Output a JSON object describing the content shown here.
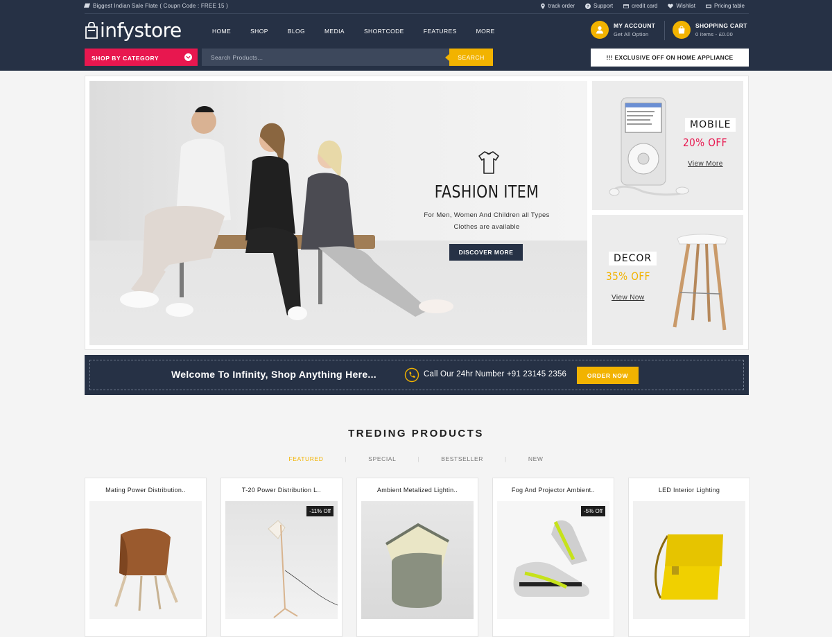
{
  "topbar": {
    "promo": "Biggest Indian Sale Flate ( Coupn Code : FREE 15 )",
    "links": [
      {
        "label": "track order",
        "icon": "location-pin-icon"
      },
      {
        "label": "Support",
        "icon": "help-circle-icon"
      },
      {
        "label": "credit card",
        "icon": "credit-card-icon"
      },
      {
        "label": "Wishlist",
        "icon": "heart-icon"
      },
      {
        "label": "Pricing table",
        "icon": "tag-icon"
      }
    ]
  },
  "logo": {
    "text": "infystore"
  },
  "nav": [
    "HOME",
    "SHOP",
    "BLOG",
    "MEDIA",
    "SHORTCODE",
    "FEATURES",
    "MORE"
  ],
  "account": {
    "title": "MY ACCOUNT",
    "subtitle": "Get All Option"
  },
  "cart": {
    "title": "SHOPPING CART",
    "subtitle": "0 items - £0.00"
  },
  "category_button": "SHOP BY CATEGORY",
  "search": {
    "placeholder": "Search Products...",
    "button": "SEARCH"
  },
  "exclusive": "!!! EXCLUSIVE OFF ON HOME APPLIANCE",
  "hero": {
    "title": "FASHION ITEM",
    "subtitle_line1": "For Men, Women And Children all Types",
    "subtitle_line2": "Clothes are available",
    "button": "DISCOVER MORE"
  },
  "side_banners": [
    {
      "label": "MOBILE",
      "offer": "20% OFF",
      "link": "View More",
      "offer_color": "#e8174f"
    },
    {
      "label": "DECOR",
      "offer": "35% OFF",
      "link": "View Now",
      "offer_color": "#f2b300"
    }
  ],
  "welcome": {
    "text": "Welcome To Infinity, Shop Anything Here...",
    "call": "Call Our 24hr Number +91 23145 2356",
    "button": "ORDER NOW"
  },
  "trending": {
    "title": "TREDING PRODUCTS",
    "tabs": [
      "FEATURED",
      "SPECIAL",
      "BESTSELLER",
      "NEW"
    ],
    "products": [
      {
        "name": "Mating Power Distribution..",
        "badge": ""
      },
      {
        "name": "T-20 Power Distribution L..",
        "badge": "-11% Off"
      },
      {
        "name": "Ambient Metalized Lightin..",
        "badge": ""
      },
      {
        "name": "Fog And Projector Ambient..",
        "badge": "-5% Off"
      },
      {
        "name": "LED Interior Lighting",
        "badge": ""
      }
    ]
  },
  "colors": {
    "navy": "#263145",
    "accent_yellow": "#f2b300",
    "accent_pink": "#e8174f"
  }
}
